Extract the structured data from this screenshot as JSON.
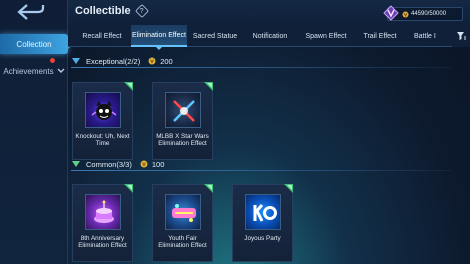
{
  "sidebar": {
    "items": [
      {
        "label": "Collection",
        "active": true
      },
      {
        "label": "Achievements",
        "active": false,
        "badge": true
      }
    ]
  },
  "header": {
    "title": "Collectible",
    "currency_value": "44590/50000"
  },
  "tabs": [
    {
      "label": "Recall Effect",
      "active": false
    },
    {
      "label": "Elimination Effect",
      "active": true
    },
    {
      "label": "Sacred Statue",
      "active": false
    },
    {
      "label": "Notification",
      "active": false
    },
    {
      "label": "Spawn Effect",
      "active": false
    },
    {
      "label": "Trail Effect",
      "active": false
    },
    {
      "label": "Battle I",
      "active": false
    }
  ],
  "sections": [
    {
      "title": "Exceptional(2/2)",
      "points": "200",
      "items": [
        {
          "name": "Knockout: Uh, Next Time",
          "icon": "dark-bat-icon"
        },
        {
          "name": "MLBB X Star Wars Elimination Effect",
          "icon": "crossed-sabers-icon"
        }
      ]
    },
    {
      "title": "Common(3/3)",
      "points": "100",
      "items": [
        {
          "name": "8th Anniversary Elimination Effect",
          "icon": "purple-cake-icon"
        },
        {
          "name": "Youth Fair Elimination Effect",
          "icon": "youth-fair-icon"
        },
        {
          "name": "Joyous Party",
          "icon": "ko-party-icon"
        }
      ]
    }
  ],
  "colors": {
    "accent": "#3da4e0",
    "active_tab_underline": "#66c2ff",
    "rarity_corner": "#3fbf7a",
    "background": "#0d1a2e"
  }
}
